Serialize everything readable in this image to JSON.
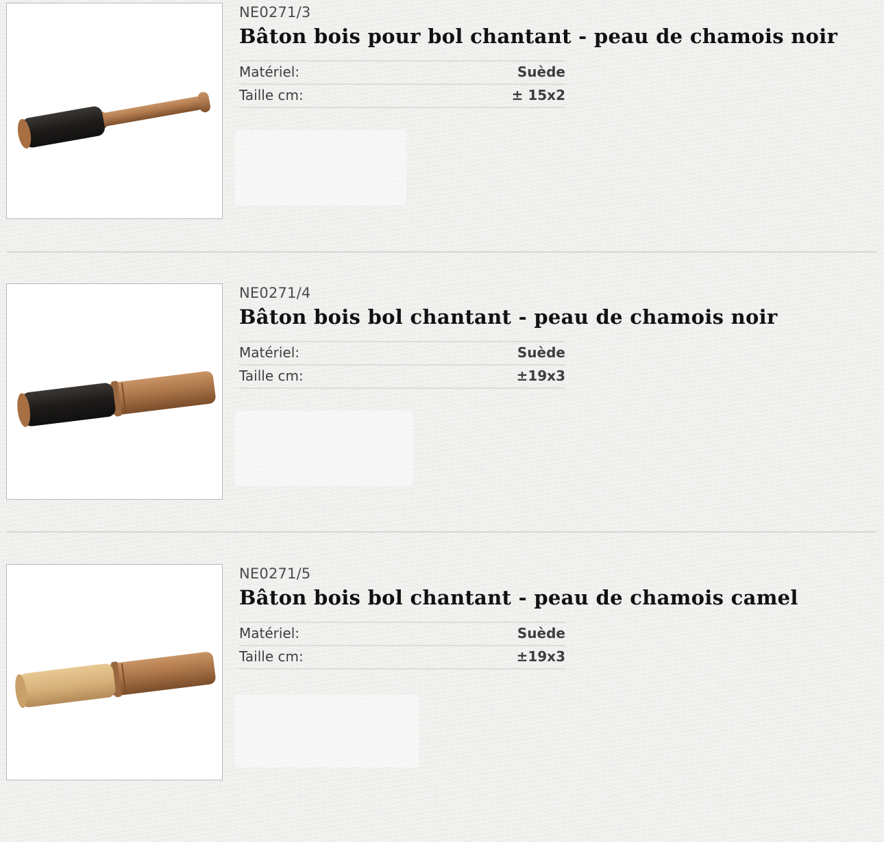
{
  "products": [
    {
      "sku": "NE0271/3",
      "title": "Bâton bois pour bol chantant - peau de chamois noir",
      "specs": [
        {
          "label": "Matériel:",
          "value": "Suède"
        },
        {
          "label": "Taille cm:",
          "value": "± 15x2"
        }
      ],
      "image_icon": "suede-mallet-black-thin"
    },
    {
      "sku": "NE0271/4",
      "title": "Bâton bois bol chantant - peau de chamois noir",
      "specs": [
        {
          "label": "Matériel:",
          "value": "Suède"
        },
        {
          "label": "Taille cm:",
          "value": "±19x3"
        }
      ],
      "image_icon": "suede-mallet-black-thick"
    },
    {
      "sku": "NE0271/5",
      "title": "Bâton bois bol chantant - peau de chamois camel",
      "specs": [
        {
          "label": "Matériel:",
          "value": "Suède"
        },
        {
          "label": "Taille cm:",
          "value": "±19x3"
        }
      ],
      "image_icon": "suede-mallet-camel-thick"
    }
  ],
  "colors": {
    "wood": "#b07a4e",
    "wood_dark": "#8a5a35",
    "suede_black": "#1e1c1a",
    "suede_camel": "#d8b27c"
  }
}
